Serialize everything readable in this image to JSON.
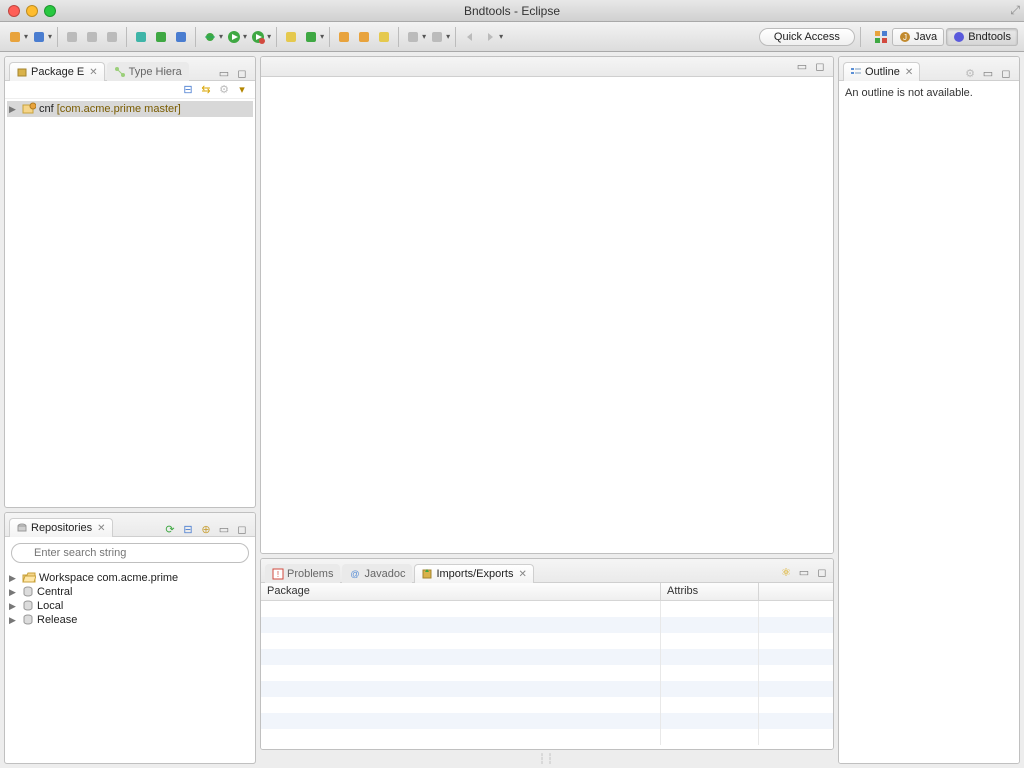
{
  "window": {
    "title": "Bndtools - Eclipse"
  },
  "toolbar": {
    "quick_access": "Quick Access"
  },
  "perspectives": {
    "java": "Java",
    "bndtools": "Bndtools"
  },
  "left": {
    "package_explorer": {
      "title": "Package E"
    },
    "type_hierarchy": {
      "title": "Type Hiera"
    },
    "tree": {
      "item0": {
        "name": "cnf",
        "decor": "[com.acme.prime master]"
      }
    },
    "repositories": {
      "title": "Repositories",
      "search_placeholder": "Enter search string",
      "items": {
        "0": "Workspace com.acme.prime",
        "1": "Central",
        "2": "Local",
        "3": "Release"
      }
    }
  },
  "bottom": {
    "problems": "Problems",
    "javadoc": "Javadoc",
    "imports_exports": "Imports/Exports",
    "cols": {
      "package": "Package",
      "attribs": "Attribs",
      "c3": ""
    }
  },
  "outline": {
    "title": "Outline",
    "message": "An outline is not available."
  }
}
